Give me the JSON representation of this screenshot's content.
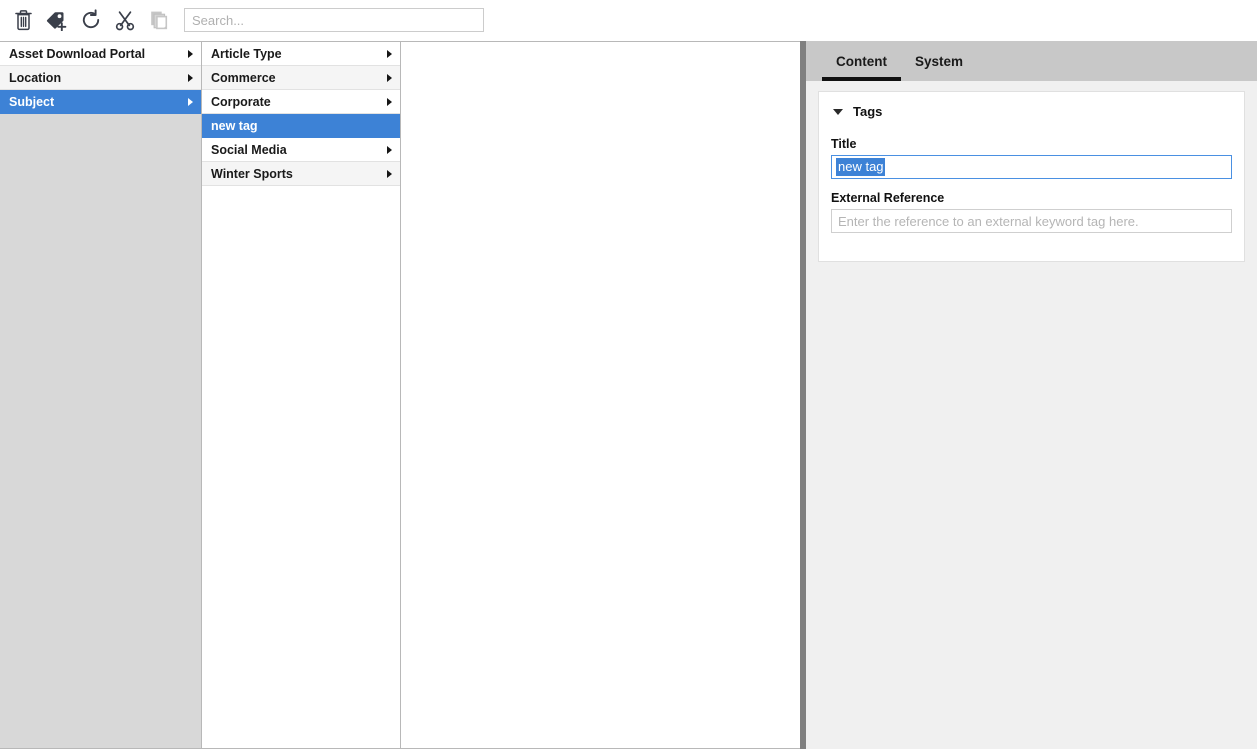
{
  "toolbar": {
    "buttons": [
      {
        "name": "delete-icon",
        "title": "Delete",
        "enabled": true
      },
      {
        "name": "add-tag-icon",
        "title": "Add Tag",
        "enabled": true
      },
      {
        "name": "refresh-icon",
        "title": "Refresh",
        "enabled": true
      },
      {
        "name": "cut-icon",
        "title": "Cut",
        "enabled": true
      },
      {
        "name": "paste-icon",
        "title": "Paste",
        "enabled": false
      }
    ],
    "search": {
      "value": "",
      "placeholder": "Search..."
    }
  },
  "browser": {
    "columns": [
      {
        "name": "column-root",
        "items": [
          {
            "label": "Asset Download Portal",
            "has_children": true,
            "selected": false
          },
          {
            "label": "Location",
            "has_children": true,
            "selected": false
          },
          {
            "label": "Subject",
            "has_children": true,
            "selected": true
          }
        ]
      },
      {
        "name": "column-subject",
        "items": [
          {
            "label": "Article Type",
            "has_children": true,
            "selected": false
          },
          {
            "label": "Commerce",
            "has_children": true,
            "selected": false
          },
          {
            "label": "Corporate",
            "has_children": true,
            "selected": false
          },
          {
            "label": "new tag",
            "has_children": false,
            "selected": true
          },
          {
            "label": "Social Media",
            "has_children": true,
            "selected": false
          },
          {
            "label": "Winter Sports",
            "has_children": true,
            "selected": false
          }
        ]
      },
      {
        "name": "column-detail",
        "items": []
      }
    ]
  },
  "right_panel": {
    "tabs": [
      {
        "label": "Content",
        "active": true
      },
      {
        "label": "System",
        "active": false
      }
    ],
    "card": {
      "title": "Tags",
      "fields": {
        "title": {
          "label": "Title",
          "value": "new tag",
          "placeholder": "",
          "focused": true,
          "text_selected": true
        },
        "external_reference": {
          "label": "External Reference",
          "value": "",
          "placeholder": "Enter the reference to an external keyword tag here.",
          "focused": false,
          "text_selected": false
        }
      }
    }
  },
  "colors": {
    "selection_blue": "#3d82d6",
    "focus_border_blue": "#4a90e2",
    "tabstrip_gray": "#c8c8c8",
    "panel_gray": "#f0f0f0",
    "column_empty_gray": "#d8d8d8",
    "splitter_gray": "#808080",
    "icon_dark": "#3a3f4a",
    "icon_disabled": "#c6c6c6"
  }
}
